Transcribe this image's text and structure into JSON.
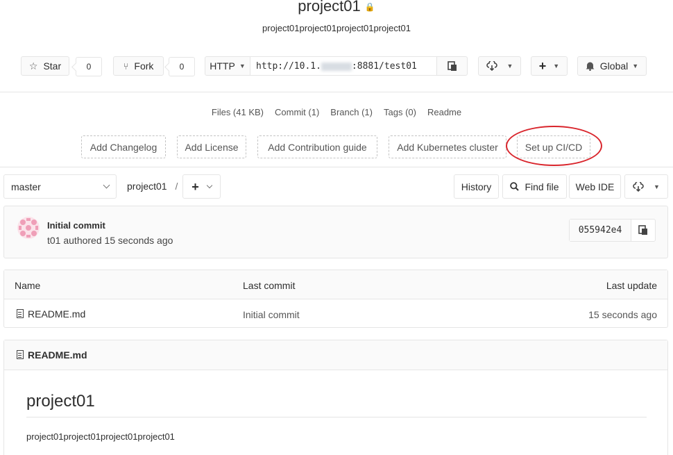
{
  "project": {
    "name": "project01",
    "description": "project01project01project01project01"
  },
  "actions": {
    "star_label": "Star",
    "star_count": "0",
    "fork_label": "Fork",
    "fork_count": "0",
    "protocol": "HTTP",
    "clone_url_prefix": "http://10.1.",
    "clone_url_suffix": ":8881/test01",
    "notification_label": "Global"
  },
  "stats": {
    "files": "Files (41 KB)",
    "commits": "Commit (1)",
    "branches": "Branch (1)",
    "tags": "Tags (0)",
    "readme": "Readme"
  },
  "quick_links": {
    "changelog": "Add Changelog",
    "license": "Add License",
    "contribution": "Add Contribution guide",
    "kubernetes": "Add Kubernetes cluster",
    "cicd": "Set up CI/CD"
  },
  "tree": {
    "branch": "master",
    "breadcrumb_root": "project01",
    "breadcrumb_sep": "/",
    "history": "History",
    "find_file": "Find file",
    "web_ide": "Web IDE"
  },
  "last_commit": {
    "title": "Initial commit",
    "author": "t01",
    "authored": "authored",
    "time": "15 seconds ago",
    "sha": "055942e4"
  },
  "file_table": {
    "headers": [
      "Name",
      "Last commit",
      "Last update"
    ],
    "rows": [
      {
        "name": "README.md",
        "commit": "Initial commit",
        "updated": "15 seconds ago"
      }
    ]
  },
  "readme_panel": {
    "filename": "README.md",
    "heading": "project01",
    "body": "project01project01project01project01"
  },
  "colors": {
    "highlight_ellipse": "#d9252c",
    "border": "#e5e5e5",
    "header_bg": "#fafafa"
  }
}
